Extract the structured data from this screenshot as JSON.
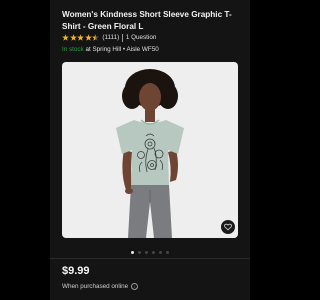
{
  "product": {
    "title": "Women's Kindness Short Sleeve Graphic T-Shirt - Green Floral L",
    "rating_stars": 4.5,
    "rating_count": "(1111)",
    "questions": "1 Question"
  },
  "availability": {
    "status": "In stock",
    "location": "at Spring Hill • Aisle WF50"
  },
  "gallery": {
    "image_count": 6,
    "active_index": 0,
    "favorite_icon": "heart-icon"
  },
  "pricing": {
    "price": "$9.99",
    "note": "When purchased online"
  },
  "colors": {
    "background": "#141414",
    "star": "#f0b31d",
    "in_stock": "#2e9e44",
    "shirt": "#b6c8bf"
  }
}
